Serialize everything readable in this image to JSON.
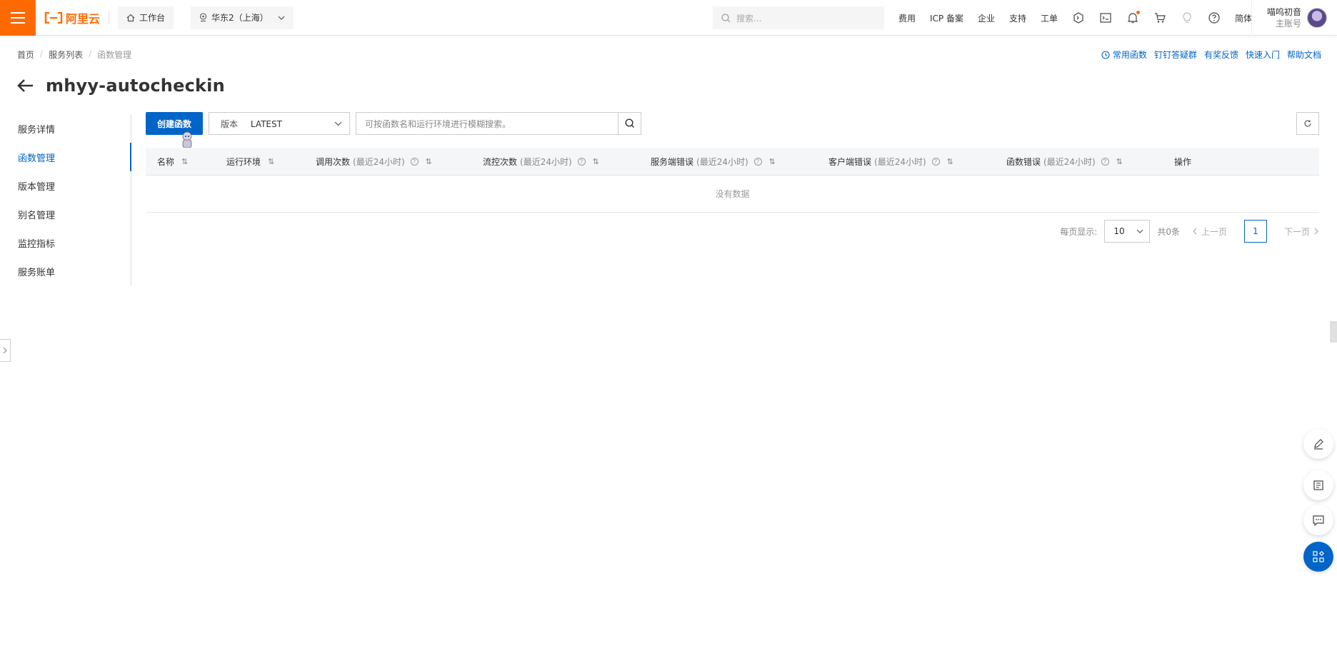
{
  "topbar": {
    "brand": "阿里云",
    "workbench": "工作台",
    "region": "华东2（上海）",
    "search_placeholder": "搜索...",
    "nav": [
      "费用",
      "ICP 备案",
      "企业",
      "支持",
      "工单"
    ],
    "lang": "简体",
    "account_name": "喵呜初音",
    "account_role": "主账号"
  },
  "breadcrumb": [
    "首页",
    "服务列表",
    "函数管理"
  ],
  "help_links": [
    "常用函数",
    "钉钉答疑群",
    "有奖反馈",
    "快速入门",
    "帮助文档"
  ],
  "page_title": "mhyy-autocheckin",
  "sidebar": {
    "items": [
      "服务详情",
      "函数管理",
      "版本管理",
      "别名管理",
      "监控指标",
      "服务账单"
    ],
    "active_index": 1
  },
  "toolbar": {
    "create_label": "创建函数",
    "version_label": "版本",
    "version_value": "LATEST",
    "search_placeholder": "可按函数名和运行环境进行模糊搜索。"
  },
  "table": {
    "columns": [
      {
        "label": "名称",
        "hint": ""
      },
      {
        "label": "运行环境",
        "hint": ""
      },
      {
        "label": "调用次数",
        "hint": "(最近24小时)"
      },
      {
        "label": "流控次数",
        "hint": "(最近24小时)"
      },
      {
        "label": "服务端错误",
        "hint": "(最近24小时)"
      },
      {
        "label": "客户端错误",
        "hint": "(最近24小时)"
      },
      {
        "label": "函数错误",
        "hint": "(最近24小时)"
      },
      {
        "label": "操作",
        "hint": ""
      }
    ],
    "empty_text": "没有数据"
  },
  "pagination": {
    "page_size_label": "每页显示:",
    "page_size": "10",
    "total": "共0条",
    "prev": "上一页",
    "current_page": "1",
    "next": "下一页"
  },
  "colors": {
    "brand": "#ff6a00",
    "primary": "#0064c8"
  }
}
